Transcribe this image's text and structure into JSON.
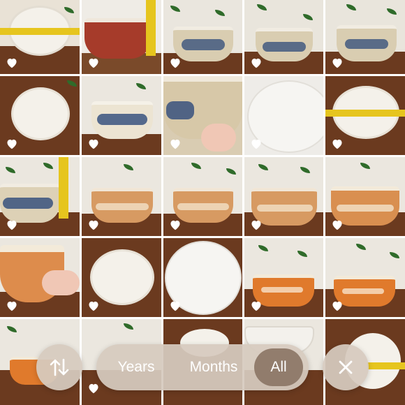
{
  "photos": [
    {
      "liked": true
    },
    {
      "liked": true
    },
    {
      "liked": true
    },
    {
      "liked": true
    },
    {
      "liked": true
    },
    {
      "liked": true
    },
    {
      "liked": true
    },
    {
      "liked": true
    },
    {
      "liked": true
    },
    {
      "liked": true
    },
    {
      "liked": true
    },
    {
      "liked": true
    },
    {
      "liked": true
    },
    {
      "liked": true
    },
    {
      "liked": true
    },
    {
      "liked": true
    },
    {
      "liked": true
    },
    {
      "liked": true
    },
    {
      "liked": true
    },
    {
      "liked": true
    },
    {
      "liked": true
    },
    {
      "liked": true
    },
    {
      "liked": false
    },
    {
      "liked": false
    },
    {
      "liked": false
    }
  ],
  "controls": {
    "sort_icon": "sort-arrows-icon",
    "segments": [
      "Years",
      "Months",
      "All"
    ],
    "selected_segment": "All",
    "close_icon": "close-icon"
  },
  "colors": {
    "control_bg": "#d6cabe",
    "control_active": "#8c7666",
    "heart": "#ffffff",
    "wood": "#6b3a1f"
  }
}
